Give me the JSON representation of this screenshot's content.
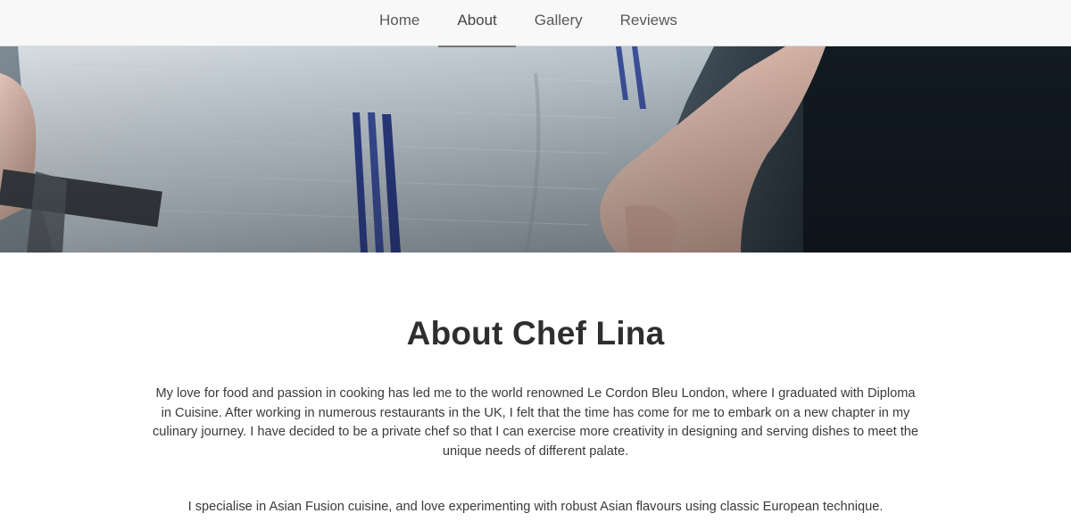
{
  "nav": {
    "items": [
      {
        "label": "Home",
        "active": false
      },
      {
        "label": "About",
        "active": true
      },
      {
        "label": "Gallery",
        "active": false
      },
      {
        "label": "Reviews",
        "active": false
      }
    ]
  },
  "about": {
    "title": "About Chef Lina",
    "paragraph_1": "My love for food and passion in cooking has led me to the world renowned Le Cordon Bleu London, where I graduated with Diploma in Cuisine. After working in numerous restaurants in the UK, I felt that the time has come for me to embark on a new chapter in my culinary journey. I have decided to be a private chef so that I can exercise more creativity in designing and serving dishes to meet the unique needs of different palate.",
    "paragraph_2": "I specialise in Asian Fusion cuisine, and love experimenting with robust Asian flavours using classic European technique."
  },
  "colors": {
    "nav_background": "#f8f8f8",
    "text": "#2f2f2f",
    "hero_dark": "#1b2630"
  }
}
